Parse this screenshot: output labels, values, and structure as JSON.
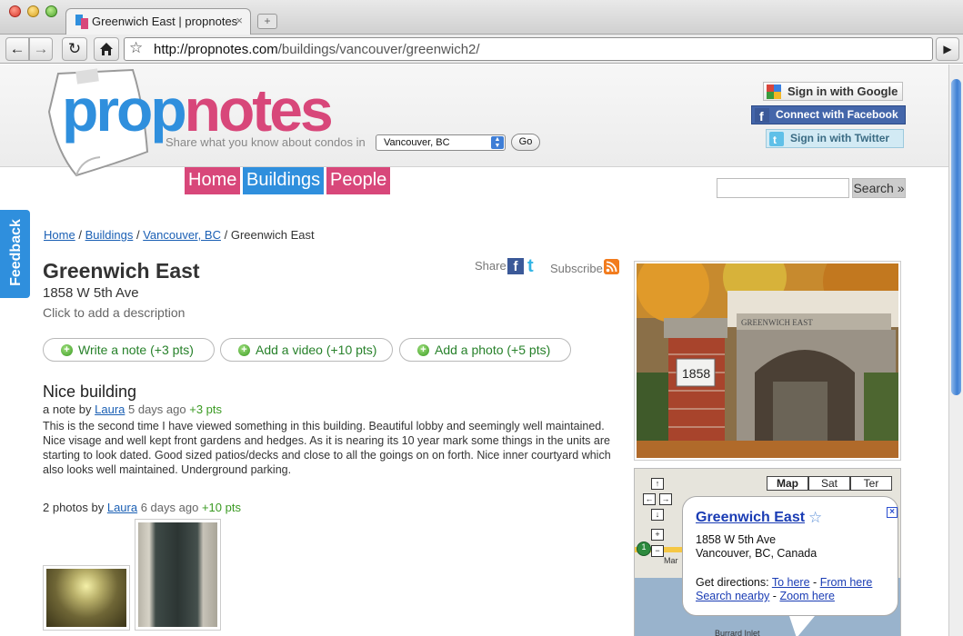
{
  "browser": {
    "tab_title": "Greenwich East | propnotes",
    "tab_close": "×",
    "url_host": "http://propnotes.com",
    "url_path": "/buildings/vancouver/greenwich2/"
  },
  "header": {
    "logo_prop": "prop",
    "logo_notes": "notes",
    "tagline": "Share what you know about condos in",
    "city_selected": "Vancouver, BC",
    "go_label": "Go",
    "signin_google": "Sign in with Google",
    "signin_facebook": "Connect with Facebook",
    "signin_twitter": "Sign in with Twitter",
    "search_button": "Search »"
  },
  "nav": {
    "home": "Home",
    "buildings": "Buildings",
    "people": "People"
  },
  "feedback_tab": "Feedback",
  "breadcrumb": {
    "home": "Home",
    "buildings": "Buildings",
    "city": "Vancouver, BC",
    "current": "Greenwich East",
    "sep": "/"
  },
  "building": {
    "name": "Greenwich East",
    "address": "1858 W 5th Ave",
    "description_prompt": "Click to add a description",
    "photo_sign_name": "GREENWICH EAST",
    "photo_sign_number": "1858"
  },
  "social": {
    "share_label": "Share",
    "subscribe_label": "Subscribe"
  },
  "actions": [
    {
      "label": "Write a note (+3 pts)"
    },
    {
      "label": "Add a video (+10 pts)"
    },
    {
      "label": "Add a photo (+5 pts)"
    }
  ],
  "note": {
    "title": "Nice building",
    "prefix": "a note by",
    "author": "Laura",
    "time": "5 days ago",
    "points": "+3 pts",
    "body": "This is the second time I have viewed something in this building. Beautiful lobby and seemingly well maintained.  Nice visage and well kept front gardens and hedges. As it is nearing its 10 year mark some things in the units are starting to look dated. Good sized patios/decks and close to all the goings on on forth. Nice inner courtyard which also looks well maintained.  Underground parking."
  },
  "photos": {
    "prefix": "2 photos by",
    "author": "Laura",
    "time": "6 days ago",
    "points": "+10 pts"
  },
  "map": {
    "types": [
      "Map",
      "Sat",
      "Ter"
    ],
    "info_title": "Greenwich East",
    "info_address_1": "1858 W 5th Ave",
    "info_address_2": "Vancouver, BC, Canada",
    "directions_label": "Get directions:",
    "to_here": "To here",
    "from_here": "From here",
    "search_nearby": "Search nearby",
    "zoom_here": "Zoom here",
    "dash": "-",
    "label_burrard": "Burrard Inlet",
    "label_mar": "Mar",
    "highway_shield": "1"
  }
}
